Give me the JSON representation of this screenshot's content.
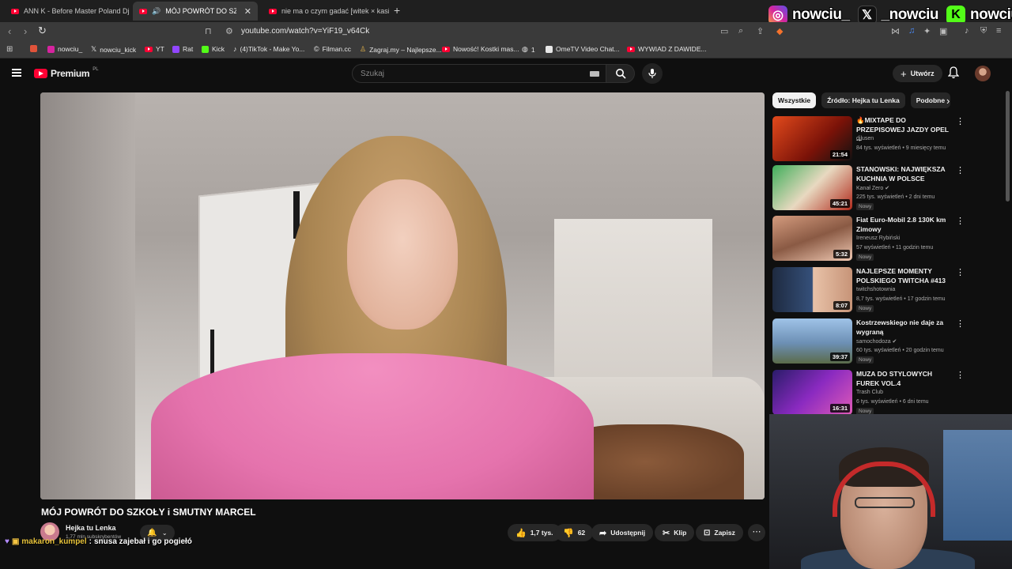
{
  "browser": {
    "tabs": [
      {
        "title": "ANN K - Before Master Poland Dj Ba...",
        "active": false
      },
      {
        "title": "MÓJ POWRÓT DO SZKOŁY i S...",
        "active": true
      },
      {
        "title": "nie ma o czym gadać [witek × kasix...",
        "active": false
      }
    ],
    "new_tab": "+",
    "url": "youtube.com/watch?v=YiF19_v64Ck",
    "bookmarks": [
      {
        "label": "",
        "color": "#e0533a"
      },
      {
        "label": "nowciu_",
        "color": "#d6249f"
      },
      {
        "label": "nowciu_kick",
        "color": "#ffffff"
      },
      {
        "label": "YT",
        "color": "#ff0033"
      },
      {
        "label": "Rat",
        "color": "#9146ff"
      },
      {
        "label": "Kick",
        "color": "#53fc18"
      },
      {
        "label": "(4)TikTok - Make Yo...",
        "color": "#25f4ee"
      },
      {
        "label": "Filman.cc",
        "color": "#cccccc"
      },
      {
        "label": "Zagraj.my – Najlepsze...",
        "color": "#e4b349"
      },
      {
        "label": "Nowość! Kostki mas...",
        "color": "#ff0033"
      },
      {
        "label": "1",
        "color": "#aaaaaa"
      },
      {
        "label": "OmeTV Video Chat...",
        "color": "#e8e8e8"
      },
      {
        "label": "WYWIAD Z DAWIDE...",
        "color": "#ff0033"
      }
    ]
  },
  "overlay": {
    "socials": [
      {
        "icon": "instagram-icon",
        "handle": "nowciu_",
        "color": "#d6249f"
      },
      {
        "icon": "x-icon",
        "handle": "_nowciu",
        "color": "#000000"
      },
      {
        "icon": "kick-icon",
        "handle": "nowciu",
        "color": "#53fc18"
      }
    ],
    "chat": {
      "user": "makaron_kumpel",
      "separator": ":",
      "message": "snusa zajebał i go pogiełó"
    }
  },
  "youtube": {
    "logo": "Premium",
    "region": "PL",
    "search_placeholder": "Szukaj",
    "create_label": "Utwórz",
    "video": {
      "title": "MÓJ POWRÓT DO SZKOŁY i SMUTNY MARCEL",
      "channel": "Hejka tu Lenka",
      "subscribers": "1,77 mln subskrybentów",
      "likes": "1,7 tys.",
      "dislikes": "62",
      "share": "Udostępnij",
      "clip": "Klip",
      "save": "Zapisz"
    },
    "chips": [
      "Wszystkie",
      "Źródło: Hejka tu Lenka",
      "Podobne"
    ],
    "recommendations": [
      {
        "title": "🔥MIXTAPE DO PRZEPISOWEJ JAZDY OPEL ...",
        "channel": "djlusen",
        "meta": "84 tys. wyświetleń • 9 miesięcy temu",
        "duration": "21:54",
        "badge": "",
        "thumb": "#b0281c"
      },
      {
        "title": "STANOWSKI: NAJWIĘKSZA KUCHNIA W POLSCE",
        "channel": "Kanał Zero",
        "meta": "225 tys. wyświetleń • 2 dni temu",
        "duration": "45:21",
        "badge": "Nowy",
        "thumb": "#2f8f4a"
      },
      {
        "title": "Fiat Euro-Mobil 2.8 130K km Zimowy",
        "channel": "Ireneusz Rybiński",
        "meta": "57 wyświetleń • 11 godzin temu",
        "duration": "5:32",
        "badge": "Nowy",
        "thumb": "#b07a5e"
      },
      {
        "title": "NAJLEPSZE MOMENTY POLSKIEGO TWITCHA #413",
        "channel": "twitchshotownia",
        "meta": "8,7 tys. wyświetleń • 17 godzin temu",
        "duration": "8:07",
        "badge": "Nowy",
        "thumb": "#2a3b5a"
      },
      {
        "title": "Kostrzewskiego nie daje za wygraną",
        "channel": "samochodoza",
        "meta": "60 tys. wyświetleń • 20 godzin temu",
        "duration": "39:37",
        "badge": "Nowy",
        "thumb": "#6f8fb8"
      },
      {
        "title": "MUZA DO STYLOWYCH FUREK VOL.4",
        "channel": "Trash Club",
        "meta": "6 tys. wyświetleń • 6 dni temu",
        "duration": "16:31",
        "badge": "Nowy",
        "thumb": "#6a2a8a"
      }
    ]
  }
}
